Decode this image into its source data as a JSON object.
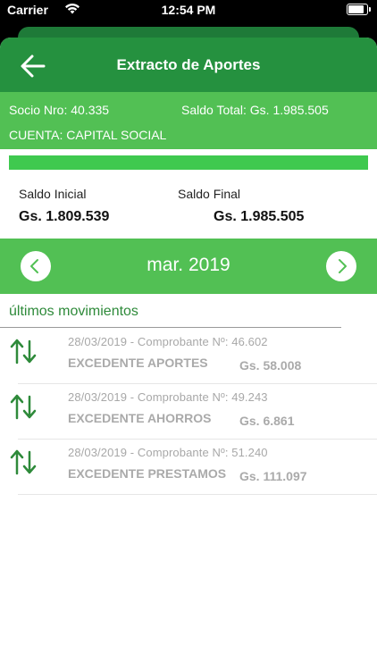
{
  "status_bar": {
    "carrier": "Carrier",
    "time": "12:54 PM"
  },
  "header": {
    "title": "Extracto de Aportes"
  },
  "account": {
    "socio": "Socio Nro: 40.335",
    "saldo_total": "Saldo Total: Gs. 1.985.505",
    "cuenta": "CUENTA: CAPITAL SOCIAL"
  },
  "progress": {
    "fraction": 1.0,
    "color": "#3fc94f"
  },
  "balances": {
    "initial_label": "Saldo Inicial",
    "initial_value": "Gs. 1.809.539",
    "final_label": "Saldo Final",
    "final_value": "Gs. 1.985.505"
  },
  "period": {
    "month": "mar. 2019"
  },
  "movements_section": {
    "title": "últimos movimientos"
  },
  "movements": [
    {
      "meta": "28/03/2019 - Comprobante Nº: 46.602",
      "concept": "EXCEDENTE APORTES",
      "amount": "Gs. 58.008"
    },
    {
      "meta": "28/03/2019 - Comprobante Nº: 49.243",
      "concept": "EXCEDENTE AHORROS",
      "amount": "Gs. 6.861"
    },
    {
      "meta": "28/03/2019 - Comprobante Nº: 51.240",
      "concept": "EXCEDENTE PRESTAMOS",
      "amount": "Gs. 111.097"
    }
  ],
  "icons": {
    "back": "arrow-left-icon",
    "prev": "chevron-left-icon",
    "next": "chevron-right-icon",
    "movement": "transfer-arrows-icon"
  },
  "colors": {
    "header_green": "#25913f",
    "panel_green": "#52c054",
    "label_green": "#2e8a3a"
  }
}
